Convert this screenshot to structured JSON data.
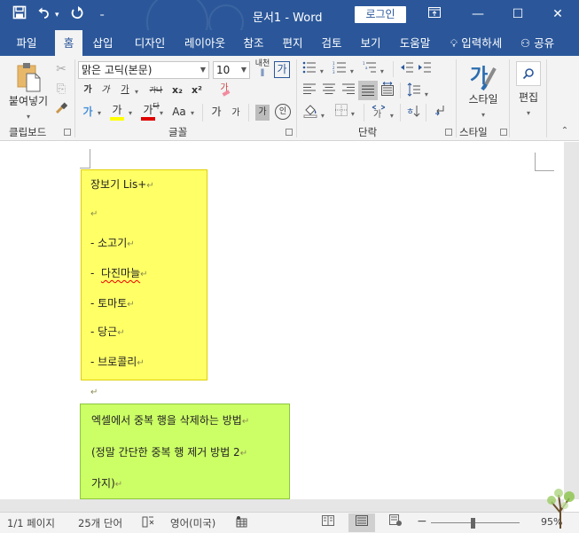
{
  "titlebar": {
    "document_title": "문서1  -  Word",
    "login_label": "로그인",
    "qat": {
      "save_icon": "save-icon",
      "undo_icon": "undo-icon",
      "redo_icon": "redo-icon",
      "customize_icon": "customize-qat-icon"
    },
    "window_buttons": {
      "ribbon_display": "⊡",
      "minimize": "—",
      "maximize": "☐",
      "close": "✕"
    }
  },
  "tabs": [
    {
      "label": "파일",
      "active": false
    },
    {
      "label": "홈",
      "active": true
    },
    {
      "label": "삽입",
      "active": false
    },
    {
      "label": "디자인",
      "active": false
    },
    {
      "label": "레이아웃",
      "active": false
    },
    {
      "label": "참조",
      "active": false
    },
    {
      "label": "편지",
      "active": false
    },
    {
      "label": "검토",
      "active": false
    },
    {
      "label": "보기",
      "active": false
    },
    {
      "label": "도움말",
      "active": false
    }
  ],
  "tell_me": "입력하세",
  "share_label": "공유",
  "ribbon": {
    "clipboard": {
      "paste_label": "붙여넣기",
      "group_label": "클립보드"
    },
    "font": {
      "font_name": "맑은 고딕(본문)",
      "font_size": "10",
      "phonetic_label": "내천",
      "char_border_label": "가",
      "bold": "가",
      "italic": "가",
      "underline": "가",
      "strikethrough": "가나다",
      "subscript": "x₂",
      "superscript": "x²",
      "clear_format": "가",
      "text_effects": "가",
      "highlight": "가",
      "font_color": "가",
      "change_case": "Aa",
      "grow_font": "가",
      "shrink_font": "가",
      "char_shading": "가",
      "enclose": "인",
      "group_label": "글꼴",
      "highlight_color": "#ffff00",
      "font_color_value": "#e00000"
    },
    "paragraph": {
      "group_label": "단락"
    },
    "styles": {
      "styles_label": "스타일",
      "group_label": "스타일"
    },
    "editing": {
      "label": "편집"
    }
  },
  "document": {
    "yellow_box": {
      "color": "#ffff66",
      "lines": [
        "장보기  Lis+",
        "",
        "-  소고기",
        "-  다진마늘",
        "-  토마토",
        "-  당근",
        "-  브로콜리"
      ]
    },
    "between_pilcrow": "↵",
    "green_box": {
      "color": "#ccff66",
      "lines": [
        "엑셀에서  중복  행을  삭제하는  방법",
        "(정말  간단한  중복  행  제거  방법  2",
        "가지)"
      ]
    }
  },
  "statusbar": {
    "page": "1/1 페이지",
    "words": "25개 단어",
    "language": "영어(미국)",
    "zoom_minus": "−",
    "zoom_percent": "95%",
    "zoom_value": 95
  }
}
